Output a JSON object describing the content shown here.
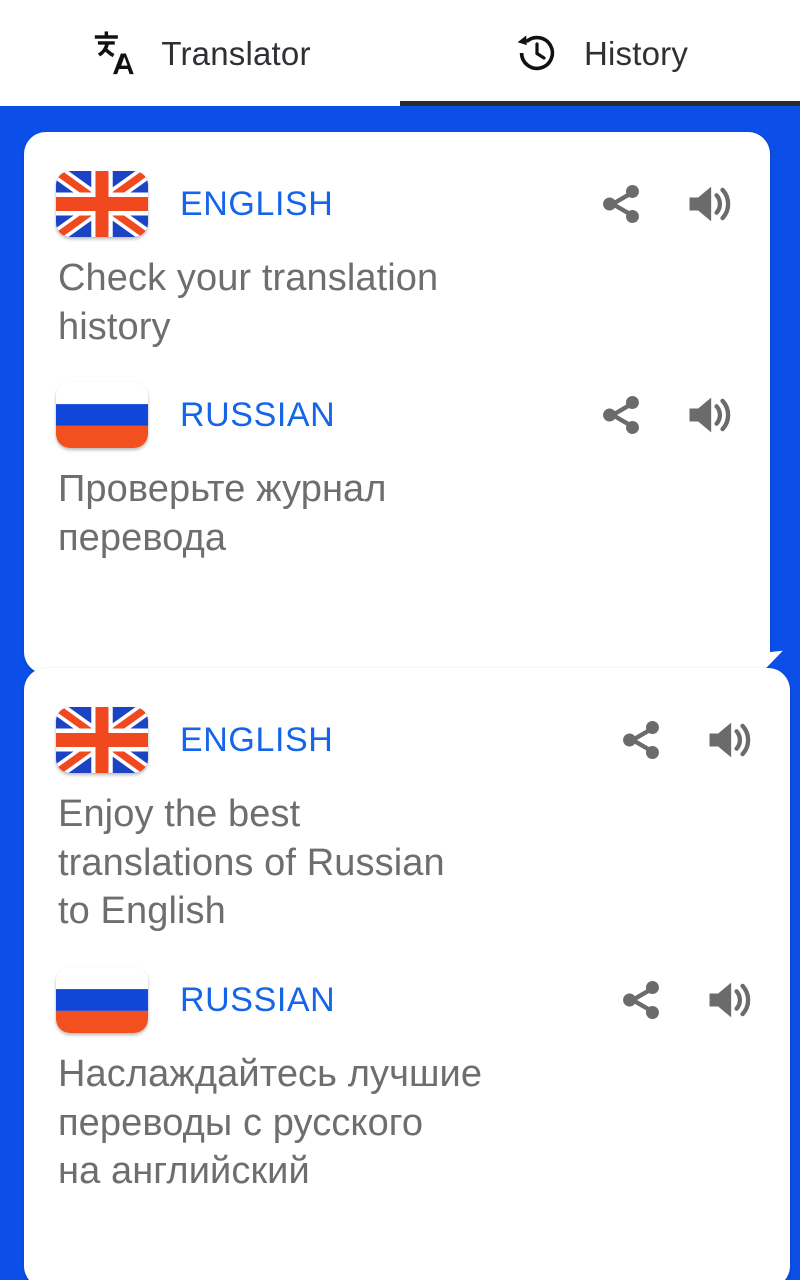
{
  "app": {
    "accent_blue": "#0b4fe8",
    "link_blue": "#1565e8",
    "body_gray": "#6e6e6e",
    "card_white": "#ffffff",
    "tab_indicator": "#2b2b2b"
  },
  "tabs": [
    {
      "id": "translator",
      "label": "Translator",
      "icon": "translate-icon",
      "active": false
    },
    {
      "id": "history",
      "label": "History",
      "icon": "history-clock-icon",
      "active": true
    }
  ],
  "history": {
    "entries": [
      {
        "source": {
          "language": "ENGLISH",
          "flag": "uk-flag-icon",
          "text": "Check your translation\nhistory",
          "share_icon": "share-icon",
          "speak_icon": "volume-up-icon"
        },
        "target": {
          "language": "RUSSIAN",
          "flag": "russia-flag-icon",
          "text": "Проверьте журнал\nперевода",
          "share_icon": "share-icon",
          "speak_icon": "volume-up-icon"
        }
      },
      {
        "source": {
          "language": "ENGLISH",
          "flag": "uk-flag-icon",
          "text": "Enjoy the best\ntranslations of Russian\nto English",
          "share_icon": "share-icon",
          "speak_icon": "volume-up-icon"
        },
        "target": {
          "language": "RUSSIAN",
          "flag": "russia-flag-icon",
          "text": "Наслаждайтесь лучшие\nпереводы с русского\nна английский",
          "share_icon": "share-icon",
          "speak_icon": "volume-up-icon"
        }
      }
    ]
  }
}
